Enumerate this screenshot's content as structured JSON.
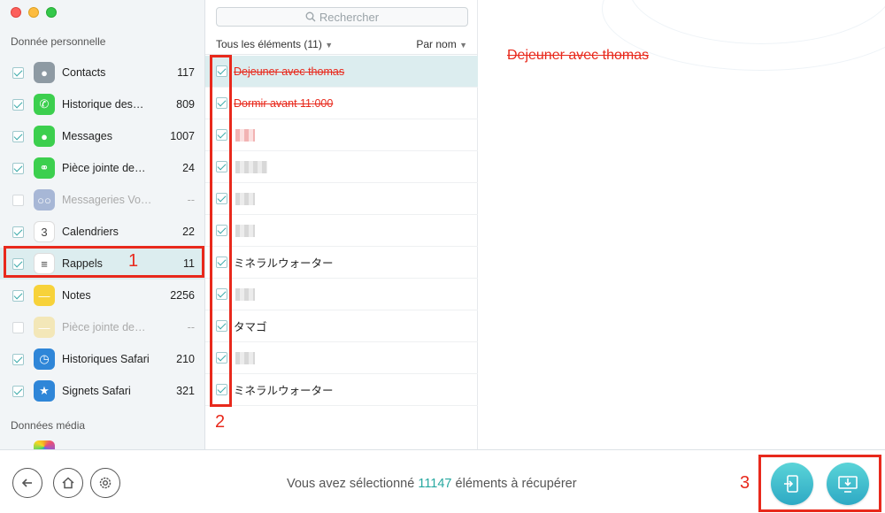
{
  "sidebar": {
    "section_personal": "Donnée personnelle",
    "section_media": "Données média",
    "items": [
      {
        "label": "Contacts",
        "count": "117",
        "checked": true,
        "icon": "contacts-icon",
        "color": "#8e9aa3"
      },
      {
        "label": "Historique des…",
        "count": "809",
        "checked": true,
        "icon": "phone-icon",
        "color": "#3ccf4e"
      },
      {
        "label": "Messages",
        "count": "1007",
        "checked": true,
        "icon": "messages-icon",
        "color": "#3ccf4e"
      },
      {
        "label": "Pièce jointe de…",
        "count": "24",
        "checked": true,
        "icon": "attachment-icon",
        "color": "#3ccf4e"
      },
      {
        "label": "Messageries Vo…",
        "count": "--",
        "checked": false,
        "icon": "voicemail-icon",
        "color": "#a7b7d6"
      },
      {
        "label": "Calendriers",
        "count": "22",
        "checked": true,
        "icon": "calendar-icon",
        "color": "#ffffff"
      },
      {
        "label": "Rappels",
        "count": "11",
        "checked": true,
        "icon": "reminders-icon",
        "color": "#ffffff",
        "selected": true
      },
      {
        "label": "Notes",
        "count": "2256",
        "checked": true,
        "icon": "notes-icon",
        "color": "#f7d23a"
      },
      {
        "label": "Pièce jointe de…",
        "count": "--",
        "checked": false,
        "icon": "note-attachment-icon",
        "color": "#f3e7b8"
      },
      {
        "label": "Historiques Safari",
        "count": "210",
        "checked": true,
        "icon": "safari-history-icon",
        "color": "#2f86d8"
      },
      {
        "label": "Signets Safari",
        "count": "321",
        "checked": true,
        "icon": "safari-bookmarks-icon",
        "color": "#2f86d8"
      }
    ]
  },
  "annotations": {
    "one": "1",
    "two": "2",
    "three": "3"
  },
  "middle": {
    "search_placeholder": "Rechercher",
    "filter_label": "Tous les éléments (11)",
    "sort_label": "Par nom",
    "rows": [
      {
        "text": "Dejeuner avec thomas",
        "style": "strike",
        "selected": true
      },
      {
        "text": "Dormir avant 11:000",
        "style": "strike"
      },
      {
        "text": "",
        "style": "pix-pink",
        "w": 22
      },
      {
        "text": "",
        "style": "pix",
        "w": 36
      },
      {
        "text": "",
        "style": "pix",
        "w": 22
      },
      {
        "text": "",
        "style": "pix",
        "w": 22
      },
      {
        "text": "ミネラルウォーター",
        "style": "normal"
      },
      {
        "text": "",
        "style": "pix",
        "w": 22
      },
      {
        "text": "タマゴ",
        "style": "normal"
      },
      {
        "text": "",
        "style": "pix",
        "w": 22
      },
      {
        "text": "ミネラルウォーター",
        "style": "normal"
      }
    ]
  },
  "detail": {
    "title": "Dejeuner avec thomas"
  },
  "footer": {
    "status_prefix": "Vous avez sélectionné ",
    "status_count": "11147",
    "status_suffix": " éléments à récupérer"
  },
  "colors": {
    "accent": "#27a8a0",
    "annotation_red": "#e8291c",
    "selected_bg": "#dcedef"
  }
}
